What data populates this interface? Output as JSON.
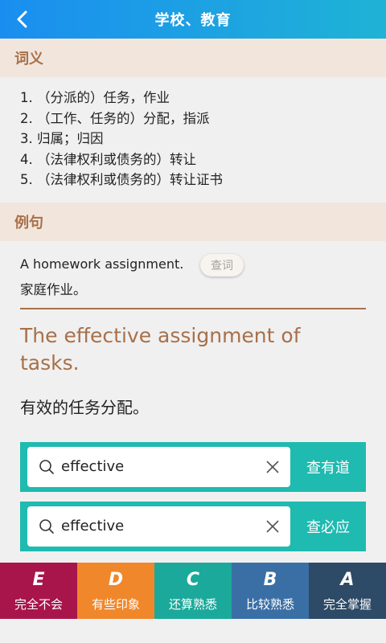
{
  "header": {
    "title": "学校、教育",
    "back_icon": "chevron-left-icon"
  },
  "meanings": {
    "heading": "词义",
    "items": [
      "1. （分派的）任务，作业",
      "2. （工作、任务的）分配，指派",
      "3. 归属；归因",
      "4. （法律权利或债务的）转让",
      "5. （法律权利或债务的）转让证书"
    ]
  },
  "examples": {
    "heading": "例句",
    "first_en": "A homework assignment.",
    "lookup_label": "查词",
    "first_zh": "家庭作业。",
    "big_en": "The effective assignment of tasks.",
    "big_zh": "有效的任务分配。"
  },
  "searches": [
    {
      "value": "effective",
      "action": "查有道"
    },
    {
      "value": "effective",
      "action": "查必应"
    }
  ],
  "rating": [
    {
      "letter": "E",
      "label": "完全不会",
      "color": "#a8154a"
    },
    {
      "letter": "D",
      "label": "有些印象",
      "color": "#f0872b"
    },
    {
      "letter": "C",
      "label": "还算熟悉",
      "color": "#1aa99a"
    },
    {
      "letter": "B",
      "label": "比较熟悉",
      "color": "#3a6fa6"
    },
    {
      "letter": "A",
      "label": "完全掌握",
      "color": "#2d4a66"
    }
  ],
  "colors": {
    "header": "#1a8ef0",
    "accent": "#a8704a",
    "search_bg": "#1fbab0"
  }
}
